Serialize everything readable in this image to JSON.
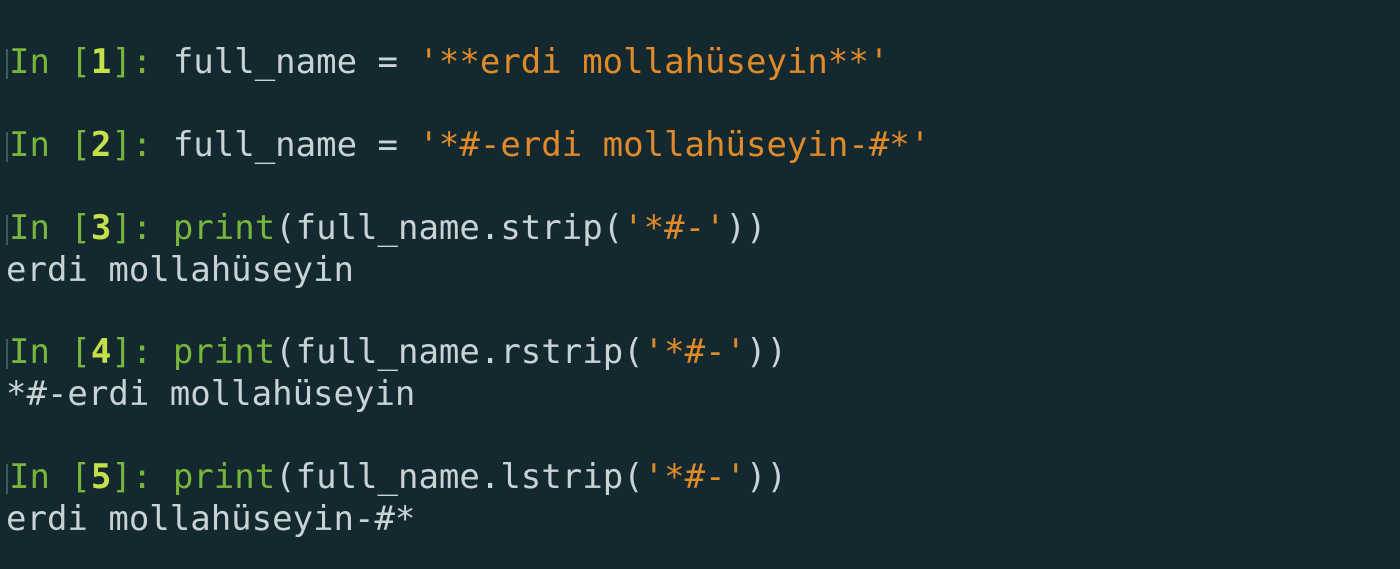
{
  "cells": [
    {
      "prompt_in": "In",
      "prompt_num": "1",
      "code_pre": "full_name = ",
      "func": "",
      "code_mid": "",
      "string": "'**erdi mollahüseyin**'",
      "code_post": "",
      "output": ""
    },
    {
      "prompt_in": "In",
      "prompt_num": "2",
      "code_pre": "full_name = ",
      "func": "",
      "code_mid": "",
      "string": "'*#-erdi mollahüseyin-#*'",
      "code_post": "",
      "output": ""
    },
    {
      "prompt_in": "In",
      "prompt_num": "3",
      "code_pre": "",
      "func": "print",
      "code_mid": "(full_name.strip(",
      "string": "'*#-'",
      "code_post": "))",
      "output": "erdi mollahüseyin"
    },
    {
      "prompt_in": "In",
      "prompt_num": "4",
      "code_pre": "",
      "func": "print",
      "code_mid": "(full_name.rstrip(",
      "string": "'*#-'",
      "code_post": "))",
      "output": "*#-erdi mollahüseyin"
    },
    {
      "prompt_in": "In",
      "prompt_num": "5",
      "code_pre": "",
      "func": "print",
      "code_mid": "(full_name.lstrip(",
      "string": "'*#-'",
      "code_post": "))",
      "output": "erdi mollahüseyin-#*"
    }
  ],
  "colors": {
    "background": "#13292f",
    "prompt": "#77b53b",
    "prompt_number": "#c5e04a",
    "string": "#e08a2a",
    "text": "#c9d2d4"
  }
}
